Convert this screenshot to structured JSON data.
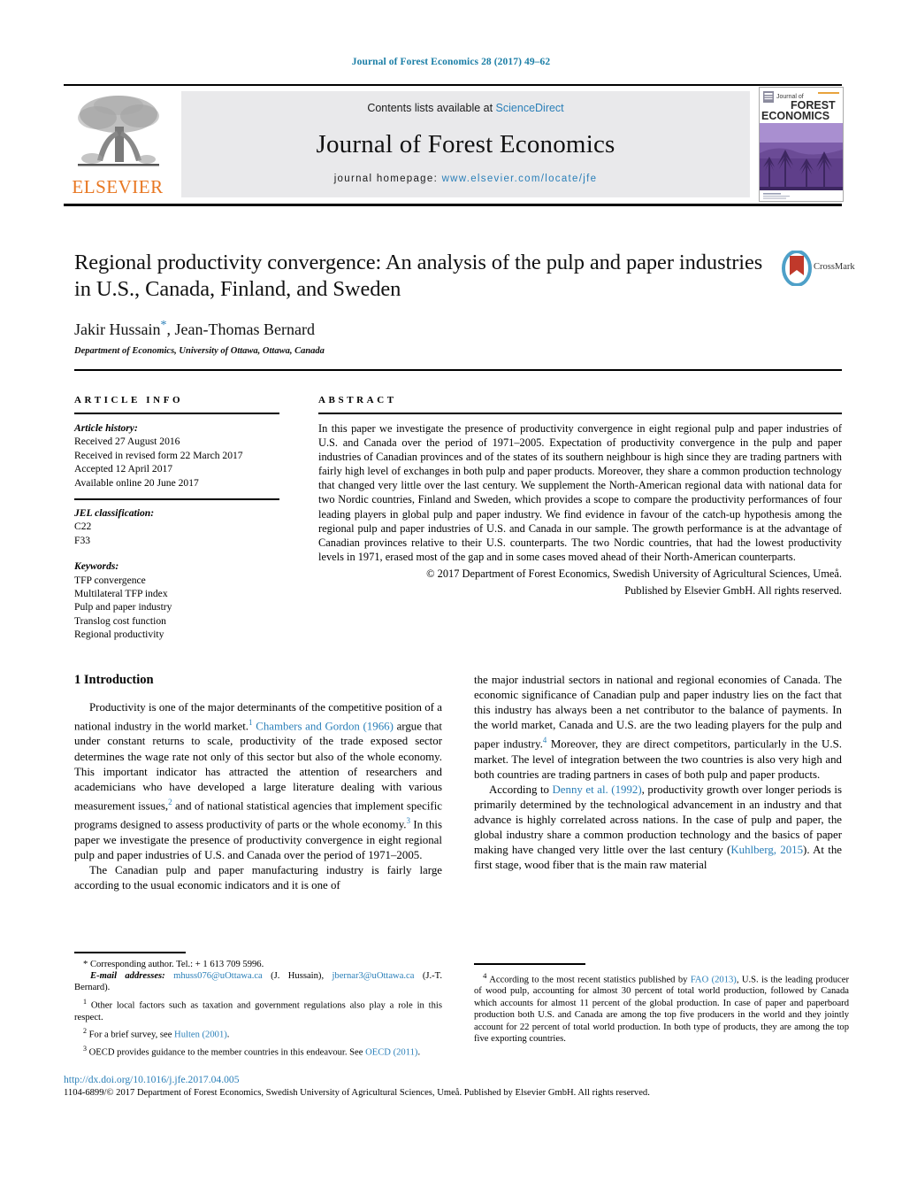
{
  "running_head": "Journal of Forest Economics 28 (2017) 49–62",
  "masthead": {
    "contents_prefix": "Contents lists available at ",
    "sciencedirect": "ScienceDirect",
    "journal_name": "Journal of Forest Economics",
    "homepage_prefix": "journal homepage: ",
    "homepage_url": "www.elsevier.com/locate/jfe",
    "publisher_logo_text": "ELSEVIER",
    "cover": {
      "line1": "Journal of",
      "line2": "FOREST",
      "line3": "ECONOMICS"
    }
  },
  "article": {
    "title": "Regional productivity convergence: An analysis of the pulp and paper industries in U.S., Canada, Finland, and Sweden",
    "authors": "Jakir Hussain",
    "authors_rest": ", Jean-Thomas Bernard",
    "corresponding_marker": "*",
    "affiliation": "Department of Economics, University of Ottawa, Ottawa, Canada",
    "crossmark_label": "CrossMark"
  },
  "article_info": {
    "heading": "ARTICLE INFO",
    "history_label": "Article history:",
    "history": [
      "Received 27 August 2016",
      "Received in revised form 22 March 2017",
      "Accepted 12 April 2017",
      "Available online 20 June 2017"
    ],
    "jel_label": "JEL classification:",
    "jel": [
      "C22",
      "F33"
    ],
    "keywords_label": "Keywords:",
    "keywords": [
      "TFP convergence",
      "Multilateral TFP index",
      "Pulp and paper industry",
      "Translog cost function",
      "Regional productivity"
    ]
  },
  "abstract": {
    "heading": "ABSTRACT",
    "text": "In this paper we investigate the presence of productivity convergence in eight regional pulp and paper industries of U.S. and Canada over the period of 1971–2005. Expectation of productivity convergence in the pulp and paper industries of Canadian provinces and of the states of its southern neighbour is high since they are trading partners with fairly high level of exchanges in both pulp and paper products. Moreover, they share a common production technology that changed very little over the last century. We supplement the North-American regional data with national data for two Nordic countries, Finland and Sweden, which provides a scope to compare the productivity performances of four leading players in global pulp and paper industry. We find evidence in favour of the catch-up hypothesis among the regional pulp and paper industries of U.S. and Canada in our sample. The growth performance is at the advantage of Canadian provinces relative to their U.S. counterparts. The two Nordic countries, that had the lowest productivity levels in 1971, erased most of the gap and in some cases moved ahead of their North-American counterparts.",
    "copyright_line1": "© 2017 Department of Forest Economics, Swedish University of Agricultural Sciences, Umeå.",
    "copyright_line2": "Published by Elsevier GmbH. All rights reserved."
  },
  "introduction": {
    "heading": "1 Introduction",
    "left": {
      "p1_a": "Productivity is one of the major determinants of the competitive position of a national industry in the world market.",
      "p1_fn1": "1",
      "p1_ref1": "Chambers and Gordon (1966)",
      "p1_b": " argue that under constant returns to scale, productivity of the trade exposed sector determines the wage rate not only of this sector but also of the whole economy. This important indicator has attracted the attention of researchers and academicians who have developed a large literature dealing with various measurement issues,",
      "p1_fn2": "2",
      "p1_c": " and of national statistical agencies that implement specific programs designed to assess productivity of parts or the whole economy.",
      "p1_fn3": "3",
      "p1_d": " In this paper we investigate the presence of productivity convergence in eight regional pulp and paper industries of U.S. and Canada over the period of 1971–2005.",
      "p2": "The Canadian pulp and paper manufacturing industry is fairly large according to the usual economic indicators and it is one of"
    },
    "right": {
      "p2_cont_a": "the major industrial sectors in national and regional economies of Canada. The economic significance of Canadian pulp and paper industry lies on the fact that this industry has always been a net contributor to the balance of payments. In the world market, Canada and U.S. are the two leading players for the pulp and paper industry.",
      "p2_fn4": "4",
      "p2_cont_b": " Moreover, they are direct competitors, particularly in the U.S. market. The level of integration between the two countries is also very high and both countries are trading partners in cases of both pulp and paper products.",
      "p3_a": "According to ",
      "p3_ref": "Denny et al. (1992)",
      "p3_b": ", productivity growth over longer periods is primarily determined by the technological advancement in an industry and that advance is highly correlated across nations. In the case of pulp and paper, the global industry share a common production technology and the basics of paper making have changed very little over the last century (",
      "p3_ref2": "Kuhlberg, 2015",
      "p3_c": "). At the first stage, wood fiber that is the main raw material"
    }
  },
  "footnotes": {
    "left": {
      "corresponding": "* Corresponding author. Tel.: + 1 613 709 5996.",
      "email_label": "E-mail addresses:",
      "email1": "mhuss076@uOttawa.ca",
      "email1_name": " (J. Hussain), ",
      "email2": "jbernar3@uOttawa.ca",
      "email2_name": "(J.-T. Bernard).",
      "fn1_num": "1",
      "fn1": "Other local factors such as taxation and government regulations also play a role in this respect.",
      "fn2_num": "2",
      "fn2_a": "For a brief survey, see ",
      "fn2_ref": "Hulten (2001)",
      "fn2_b": ".",
      "fn3_num": "3",
      "fn3_a": "OECD provides guidance to the member countries in this endeavour. See ",
      "fn3_ref": "OECD (2011)",
      "fn3_b": "."
    },
    "right": {
      "fn4_num": "4",
      "fn4_a": "According to the most recent statistics published by ",
      "fn4_ref": "FAO (2013)",
      "fn4_b": ", U.S. is the leading producer of wood pulp, accounting for almost 30 percent of total world production, followed by Canada which accounts for almost 11 percent of the global production. In case of paper and paperboard production both U.S. and Canada are among the top five producers in the world and they jointly account for 22 percent of total world production. In both type of products, they are among the top five exporting countries."
    }
  },
  "footer": {
    "doi": "http://dx.doi.org/10.1016/j.jfe.2017.04.005",
    "issn_line": "1104-6899/© 2017 Department of Forest Economics, Swedish University of Agricultural Sciences, Umeå. Published by Elsevier GmbH. All rights reserved."
  },
  "colors": {
    "link": "#2a7fb8",
    "running_head": "#1b7ea6",
    "elsevier_orange": "#e87722",
    "masthead_bg": "#e9e9eb",
    "cover_purple": "#7b5ea8"
  }
}
